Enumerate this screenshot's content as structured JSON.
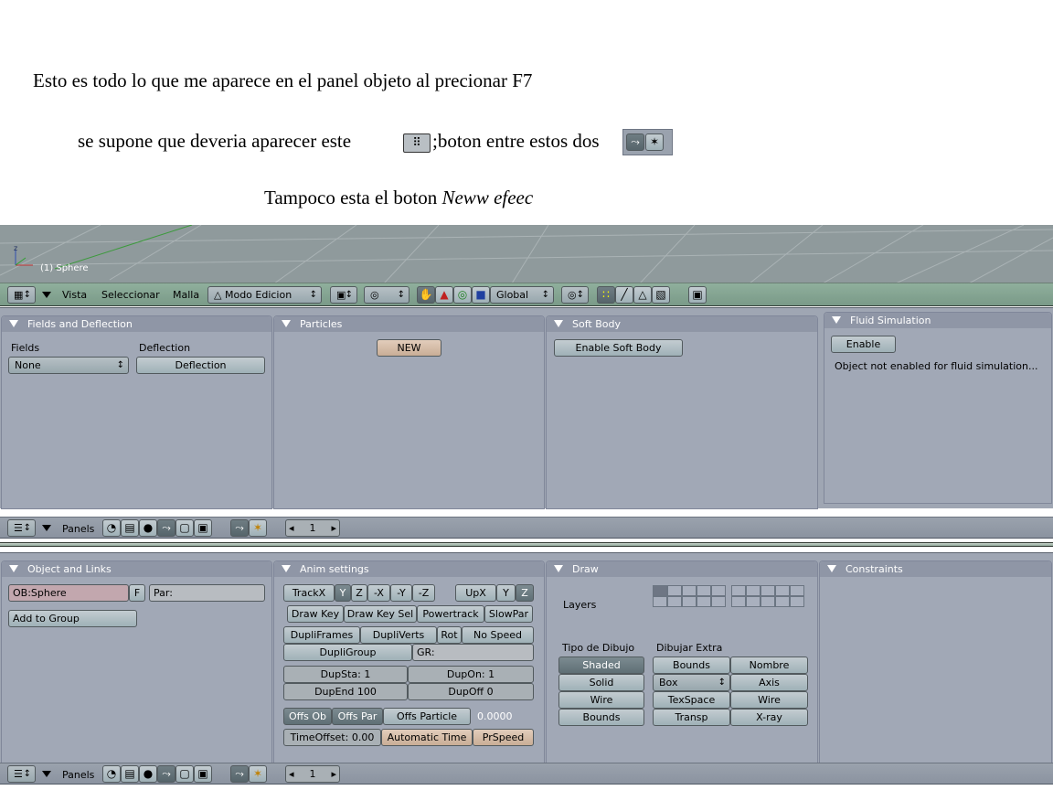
{
  "doc": {
    "line1": "Esto es todo lo que me aparece en el panel objeto al precionar F7",
    "line2a": "se supone que deveria aparecer este",
    "line2b": ";boton entre estos dos",
    "line3a": "Tampoco esta el boton ",
    "line3b": "Neww efeec"
  },
  "viewport": {
    "object_label": "(1) Sphere"
  },
  "header3d": {
    "menus": [
      "Vista",
      "Seleccionar",
      "Malla"
    ],
    "mode": "Modo Edicion",
    "orientation": "Global"
  },
  "physics": {
    "fields": {
      "title": "Fields and Deflection",
      "fields_label": "Fields",
      "deflection_label": "Deflection",
      "fields_value": "None",
      "deflection_button": "Deflection"
    },
    "particles": {
      "title": "Particles",
      "new_button": "NEW"
    },
    "softbody": {
      "title": "Soft Body",
      "enable_button": "Enable Soft Body"
    },
    "fluid": {
      "title": "Fluid Simulation",
      "enable_button": "Enable",
      "message": "Object not enabled for fluid simulation..."
    }
  },
  "buttons_header": {
    "panels_label": "Panels",
    "frame": "1"
  },
  "object": {
    "links": {
      "title": "Object and Links",
      "ob_field": "OB:Sphere",
      "f_button": "F",
      "par_field": "Par:",
      "add_group": "Add to Group"
    },
    "anim": {
      "title": "Anim settings",
      "track": "TrackX",
      "axes": [
        "Y",
        "Z",
        "-X",
        "-Y",
        "-Z"
      ],
      "upx": "UpX",
      "up_axes": [
        "Y",
        "Z"
      ],
      "row2": [
        "Draw Key",
        "Draw Key Sel",
        "Powertrack",
        "SlowPar"
      ],
      "row3": [
        "DupliFrames",
        "DupliVerts",
        "Rot",
        "No Speed"
      ],
      "dupligroup": "DupliGroup",
      "gr_field": "GR:",
      "dupsta": "DupSta: 1",
      "dupon": "DupOn: 1",
      "dupend": "DupEnd 100",
      "dupoff": "DupOff 0",
      "offs_ob": "Offs Ob",
      "offs_par": "Offs Par",
      "offs_particle": "Offs Particle",
      "offs_value": "0.0000",
      "timeoffset": "TimeOffset: 0.00",
      "automatic_time": "Automatic Time",
      "prspeed": "PrSpeed"
    },
    "draw": {
      "title": "Draw",
      "layers_label": "Layers",
      "tipo_label": "Tipo de Dibujo",
      "extra_label": "Dibujar Extra",
      "tipo": [
        "Shaded",
        "Solid",
        "Wire",
        "Bounds"
      ],
      "extra_left": [
        "Bounds",
        "Box",
        "TexSpace",
        "Transp"
      ],
      "extra_right": [
        "Nombre",
        "Axis",
        "Wire",
        "X-ray"
      ]
    },
    "constraints": {
      "title": "Constraints"
    }
  }
}
